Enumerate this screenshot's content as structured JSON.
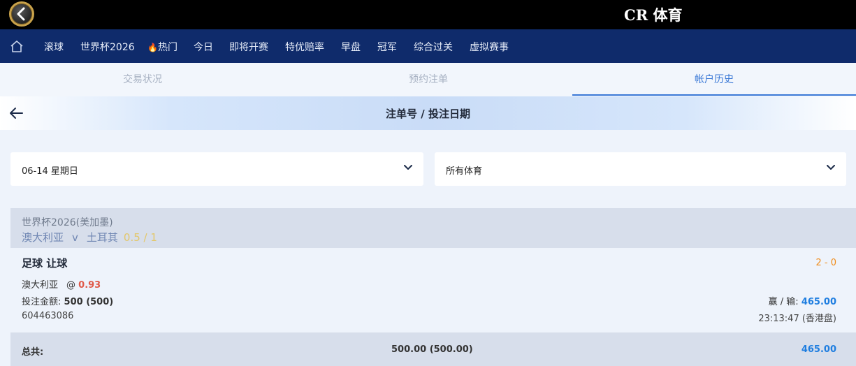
{
  "brand": "CR 体育",
  "nav": {
    "items": [
      "滚球",
      "世界杯2026",
      "热门",
      "今日",
      "即将开赛",
      "特优赔率",
      "早盘",
      "冠军",
      "综合过关",
      "虚拟赛事"
    ]
  },
  "tabs": [
    {
      "label": "交易状况",
      "active": false
    },
    {
      "label": "预约注单",
      "active": false
    },
    {
      "label": "帐户历史",
      "active": true
    }
  ],
  "subheader": {
    "title": "注单号 / 投注日期"
  },
  "filters": {
    "date": "06-14 星期日",
    "sport": "所有体育"
  },
  "bet": {
    "league": "世界杯2026(美加墨)",
    "home": "澳大利亚",
    "vs": "v",
    "away": "土耳其",
    "handicap": "0.5 / 1",
    "bet_type": "足球 让球",
    "score": "2 - 0",
    "selection": "澳大利亚",
    "at": "@",
    "odds": "0.93",
    "stake_label": "投注金额:",
    "stake_value": "500 (500)",
    "winloss_label": "赢 / 输:",
    "winloss_value": "465.00",
    "bet_id": "604463086",
    "bet_time": "23:13:47 (香港盘)"
  },
  "totals": {
    "label": "总共:",
    "stake": "500.00 (500.00)",
    "winloss": "465.00"
  },
  "colors": {
    "topbar": "#000000",
    "navbar": "#0f2b6b",
    "accent": "#3a78d6",
    "win": "#1f7ee0",
    "odds": "#e05a4a",
    "score": "#f08c1a"
  }
}
